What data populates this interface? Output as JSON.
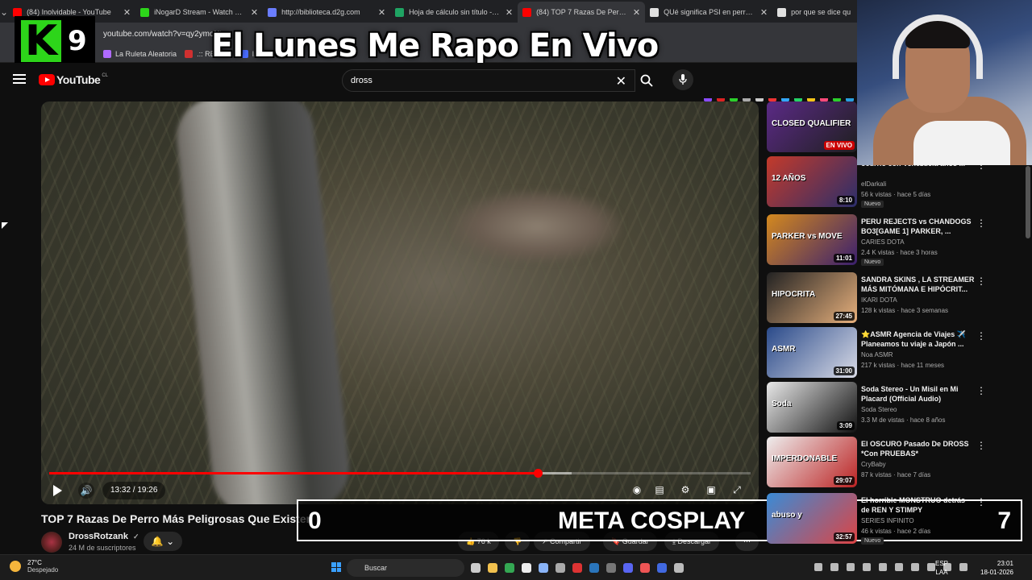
{
  "browser": {
    "tabs": [
      {
        "label": "(84) Inolvidable - YouTube",
        "color": "#ff0000"
      },
      {
        "label": "iNogarD Stream - Watch Live o",
        "color": "#2dd51a"
      },
      {
        "label": "http://biblioteca.d2g.com",
        "color": "#6a7dff"
      },
      {
        "label": "Hoja de cálculo sin título - Hoja",
        "color": "#1fa463"
      },
      {
        "label": "(84) TOP 7 Razas De Perro M",
        "color": "#ff0000",
        "active": true
      },
      {
        "label": "QUé significa PSI en perros - Bu",
        "color": "#e0e0e0"
      },
      {
        "label": "por que se dice qu",
        "color": "#e0e0e0"
      }
    ],
    "url": "youtube.com/watch?v=qy2ymoKt",
    "bookmarks": [
      {
        "label": "La Ruleta Aleatoria",
        "color": "#b06bff"
      },
      {
        "label": ".:: REGIST",
        "color": "#d03030"
      },
      {
        "label": "Inbo",
        "color": "#4a6cff"
      }
    ]
  },
  "overlay": {
    "logo_letter": "K",
    "logo_number": "9",
    "headline": "El Lunes Me Rapo En Vivo",
    "bar_left": "0",
    "bar_center": "META COSPLAY",
    "bar_right": "7"
  },
  "youtube": {
    "logo_text": "YouTube",
    "country": "CL",
    "search_value": "dross",
    "video": {
      "current_time": "13:32",
      "duration": "19:26",
      "time_label": "13:32 / 19:26",
      "progress_fraction": 0.6964,
      "buffered_fraction": 0.745
    },
    "title": "TOP 7 Razas De Perro Más Peligrosas Que Existen",
    "channel": "DrossRotzank",
    "verified": "✓",
    "subscribers": "24 M de suscriptores",
    "actions": [
      {
        "label": "👍 76 k"
      },
      {
        "label": "👎"
      },
      {
        "label": "↗ Compartir"
      },
      {
        "label": "🔖 Guardar"
      },
      {
        "label": "⤓ Descargar"
      },
      {
        "label": "···"
      }
    ]
  },
  "recommendations": [
    {
      "title": "",
      "channel": "",
      "meta": "",
      "duration": "",
      "live": "EN VIVO",
      "new": "",
      "thumb_text": "CLOSED QUALIFIER",
      "colors": [
        "#5b2a86",
        "#1f1f1f"
      ]
    },
    {
      "title": "ocurrió con Venezuela años ...",
      "channel": "elDarkali",
      "meta": "56 k vistas · hace 5 días",
      "duration": "8:10",
      "new": "Nuevo",
      "thumb_text": "12 AÑOS",
      "colors": [
        "#c43a2a",
        "#2a2e6b"
      ]
    },
    {
      "title": "PERU REJECTS vs CHANDOGS BO3[GAME 1] PARKER, ...",
      "channel": "CARIES DOTA",
      "meta": "2.4 K vistas · hace 3 horas",
      "duration": "11:01",
      "new": "Nuevo",
      "thumb_text": "PARKER vs MOVE",
      "colors": [
        "#d4891e",
        "#3a1f6e"
      ]
    },
    {
      "title": "SANDRA SKINS , LA STREAMER MÁS MITÓMANA E HIPÓCRIT...",
      "channel": "IKARI DOTA",
      "meta": "128 k vistas · hace 3 semanas",
      "duration": "27:45",
      "new": "",
      "thumb_text": "HIPOCRITA",
      "colors": [
        "#222",
        "#e7b07c"
      ]
    },
    {
      "title": "⭐ASMR Agencia de Viajes ✈️ Planeamos tu viaje a Japón ...",
      "channel": "Noa ASMR",
      "meta": "217 k vistas · hace 11 meses",
      "duration": "31:00",
      "new": "",
      "thumb_text": "ASMR",
      "colors": [
        "#2a4a8a",
        "#d9dbe6"
      ]
    },
    {
      "title": "Soda Stereo - Un Misil en Mi Placard (Official Audio)",
      "channel": "Soda Stereo",
      "meta": "3.3 M de vistas · hace 8 años",
      "duration": "3:09",
      "new": "",
      "thumb_text": "Soda",
      "colors": [
        "#e8e8e8",
        "#111"
      ]
    },
    {
      "title": "El OSCURO Pasado De DROSS *Con PRUEBAS*",
      "channel": "CryBaby",
      "meta": "87 k vistas · hace 7 días",
      "duration": "29:07",
      "new": "",
      "thumb_text": "IMPERDONABLE",
      "colors": [
        "#eee",
        "#b22"
      ]
    },
    {
      "title": "El horrible MONSTRUO detrás de REN Y STIMPY",
      "channel": "SERIES INFINITO",
      "meta": "46 k vistas · hace 2 días",
      "duration": "32:57",
      "new": "Nuevo",
      "thumb_text": "abuso y",
      "colors": [
        "#3a8bd6",
        "#d44"
      ]
    }
  ],
  "taskbar": {
    "temperature": "27°C",
    "weather": "Despejado",
    "search_placeholder": "Buscar",
    "lang_top": "ESP",
    "lang_bottom": "LAA",
    "time": "23:01",
    "date": "18-01-2026"
  }
}
